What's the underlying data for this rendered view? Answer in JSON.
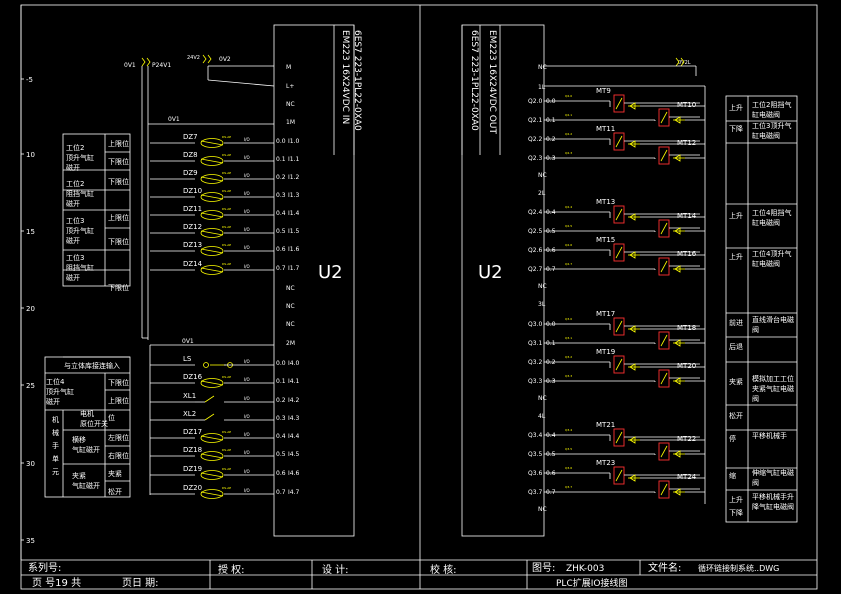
{
  "title_block": {
    "series_label": "系列号:",
    "page_label": "页 号19 共",
    "page_sheet": "页日 期:",
    "approve_label": "授 权:",
    "design_label": "设 计:",
    "check_label": "校 核:",
    "drawing_no_label": "图号:",
    "drawing_no": "ZHK-003",
    "file_label": "文件名:",
    "file_name": "循环链接制系统..DWG",
    "drawing_title": "PLC扩展IO接线图"
  },
  "ruler_marks": [
    "-5",
    "10",
    "15",
    "20",
    "25",
    "30",
    "35"
  ],
  "left_module": {
    "model": "EM223 16X24VDC IN",
    "order_no": "6ES7 223-1PL22-0XA0",
    "name": "U2",
    "supply_labels": {
      "a": "0V1",
      "b": "P24V1",
      "c": "24V2",
      "d": "0V2",
      "e": "0V1",
      "f": "0V1"
    },
    "top_terminals": [
      "M",
      "L+",
      "NC",
      "1M"
    ],
    "mid_terminals": [
      "NC",
      "NC",
      "NC",
      "2M"
    ],
    "inputs_a": [
      {
        "dev": "DZ7",
        "addr": "I1.0",
        "pin": "0.0"
      },
      {
        "dev": "DZ8",
        "addr": "I1.1",
        "pin": "0.1"
      },
      {
        "dev": "DZ9",
        "addr": "I1.2",
        "pin": "0.2"
      },
      {
        "dev": "DZ10",
        "addr": "I1.3",
        "pin": "0.3"
      },
      {
        "dev": "DZ11",
        "addr": "I1.4",
        "pin": "0.4"
      },
      {
        "dev": "DZ12",
        "addr": "I1.5",
        "pin": "0.5"
      },
      {
        "dev": "DZ13",
        "addr": "I1.6",
        "pin": "0.6"
      },
      {
        "dev": "DZ14",
        "addr": "I1.7",
        "pin": "0.7"
      }
    ],
    "inputs_b": [
      {
        "dev": "LS",
        "addr": "I4.0",
        "pin": "0.0"
      },
      {
        "dev": "DZ16",
        "addr": "I4.1",
        "pin": "0.1"
      },
      {
        "dev": "XL1",
        "addr": "I4.2",
        "pin": "0.2"
      },
      {
        "dev": "XL2",
        "addr": "I4.3",
        "pin": "0.3"
      },
      {
        "dev": "DZ17",
        "addr": "I4.4",
        "pin": "0.4"
      },
      {
        "dev": "DZ18",
        "addr": "I4.5",
        "pin": "0.5"
      },
      {
        "dev": "DZ19",
        "addr": "I4.6",
        "pin": "0.6"
      },
      {
        "dev": "DZ20",
        "addr": "I4.7",
        "pin": "0.7"
      }
    ]
  },
  "left_legend": {
    "rows": [
      {
        "desc": "工位2顶升气缸磁开",
        "pos": "上限位"
      },
      {
        "desc": "",
        "pos": "下限位"
      },
      {
        "desc": "工位2阻挡气缸磁开",
        "pos": "下限位"
      },
      {
        "desc": "工位3顶升气缸磁开",
        "pos": "上限位"
      },
      {
        "desc": "",
        "pos": "下限位"
      },
      {
        "desc": "工位3阻挡气缸磁开",
        "pos": "下限位"
      }
    ],
    "header_b": "与立体库接连输入",
    "rows_b": [
      {
        "desc": "工位4顶升气缸磁开",
        "pos": "下限位"
      },
      {
        "desc": "",
        "pos": "上限位"
      },
      {
        "desc": "机械手单元",
        "sub": "电机原位开关",
        "pos": "位"
      },
      {
        "desc": "",
        "sub": "横移气缸磁开",
        "pos": "左限位"
      },
      {
        "desc": "",
        "sub": "",
        "pos": "右限位"
      },
      {
        "desc": "",
        "sub": "夹紧气缸磁开",
        "pos": "夹紧"
      },
      {
        "desc": "",
        "sub": "",
        "pos": "松开"
      }
    ]
  },
  "right_module": {
    "model": "EM223 16X24VDC OUT",
    "order_no": "6ES7 223-1PL22-0XA0",
    "name": "U2",
    "supply_label": "0V2L",
    "terminal_top": "NC",
    "groups": [
      {
        "common": "1L",
        "outs": [
          {
            "addr": "Q2.0",
            "pin": "0.0",
            "coil": "MT9"
          },
          {
            "addr": "Q2.1",
            "pin": "0.1",
            "coil": "MT10"
          },
          {
            "addr": "Q2.2",
            "pin": "0.2",
            "coil": "MT11"
          },
          {
            "addr": "Q2.3",
            "pin": "0.3",
            "coil": "MT12"
          }
        ]
      },
      {
        "common": "2L",
        "outs": [
          {
            "addr": "Q2.4",
            "pin": "0.4",
            "coil": "MT13"
          },
          {
            "addr": "Q2.5",
            "pin": "0.5",
            "coil": "MT14"
          },
          {
            "addr": "Q2.6",
            "pin": "0.6",
            "coil": "MT15"
          },
          {
            "addr": "Q2.7",
            "pin": "0.7",
            "coil": "MT16"
          }
        ]
      },
      {
        "common": "3L",
        "outs": [
          {
            "addr": "Q3.0",
            "pin": "0.0",
            "coil": "MT17"
          },
          {
            "addr": "Q3.1",
            "pin": "0.1",
            "coil": "MT18"
          },
          {
            "addr": "Q3.2",
            "pin": "0.2",
            "coil": "MT19"
          },
          {
            "addr": "Q3.3",
            "pin": "0.3",
            "coil": "MT20"
          }
        ]
      },
      {
        "common": "4L",
        "outs": [
          {
            "addr": "Q3.4",
            "pin": "0.4",
            "coil": "MT21"
          },
          {
            "addr": "Q3.5",
            "pin": "0.5",
            "coil": "MT22"
          },
          {
            "addr": "Q3.6",
            "pin": "0.6",
            "coil": "MT23"
          },
          {
            "addr": "Q3.7",
            "pin": "0.7",
            "coil": "MT24"
          }
        ]
      }
    ]
  },
  "right_legend": [
    {
      "action": "上升",
      "desc": "工位2阻挡气缸电磁阀"
    },
    {
      "action": "下降",
      "desc": "工位3顶升气缸电磁阀"
    },
    {
      "action": "上升",
      "desc": "工位4阻挡气缸电磁阀"
    },
    {
      "action": "上升",
      "desc": "工位4顶升气缸电磁阀"
    },
    {
      "action": "前进",
      "desc": "直线滑台电磁阀"
    },
    {
      "action": "后退",
      "desc": ""
    },
    {
      "action": "夹紧",
      "desc": "模拟加工工位夹紧气缸电磁阀"
    },
    {
      "action": "松开",
      "desc": ""
    },
    {
      "action": "停",
      "desc": "平移机械手"
    },
    {
      "action": "缩",
      "desc": "伸缩气缸电磁阀"
    },
    {
      "action": "上升",
      "desc": "平移机械手升降气缸电磁阀"
    },
    {
      "action": "下降",
      "desc": ""
    }
  ]
}
